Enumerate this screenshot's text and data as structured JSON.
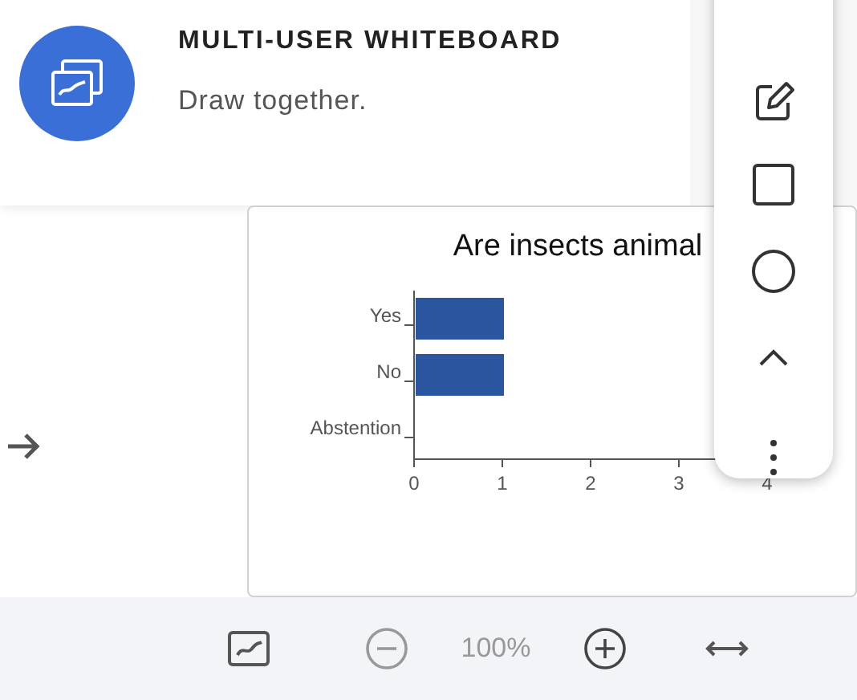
{
  "header": {
    "title": "MULTI-USER WHITEBOARD",
    "subtitle": "Draw together."
  },
  "chart_panel": {
    "chart_data": {
      "type": "bar",
      "orientation": "horizontal",
      "title": "Are insects animal",
      "categories": [
        "Yes",
        "No",
        "Abstention"
      ],
      "series": [
        {
          "color": "#2a56a0",
          "values": [
            1,
            1,
            0
          ]
        }
      ],
      "xlim": [
        0,
        4
      ],
      "xticks": [
        0,
        1,
        2,
        3,
        4
      ]
    }
  },
  "toolbar": {
    "tools": [
      {
        "kind": "pencil"
      },
      {
        "kind": "rectangle"
      },
      {
        "kind": "ellipse"
      },
      {
        "kind": "collapse"
      },
      {
        "kind": "more"
      }
    ]
  },
  "zoom_bar": {
    "zoom_out": {
      "disabled": true
    },
    "zoom": "100%",
    "zoom_in": {
      "disabled": false
    }
  }
}
